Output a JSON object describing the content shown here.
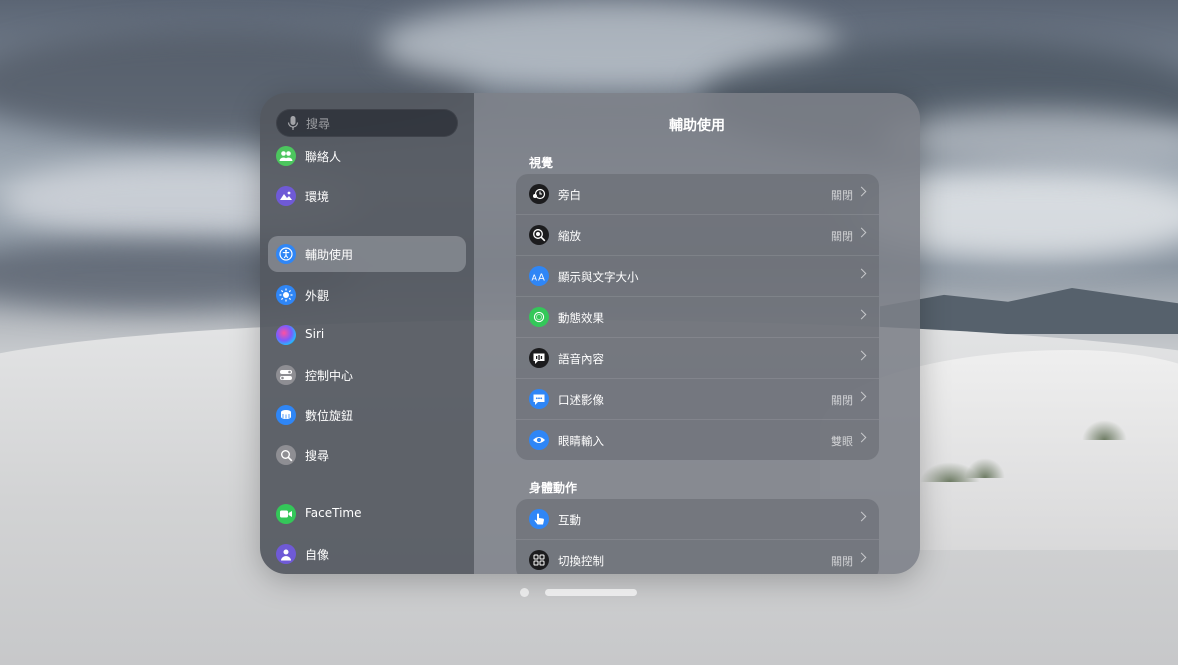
{
  "search": {
    "placeholder": "搜尋"
  },
  "sidebar": {
    "items": [
      {
        "label": "聯絡人",
        "icon": "contacts-icon",
        "color": "#4cc65e"
      },
      {
        "label": "環境",
        "icon": "environment-icon",
        "color": "#6f5ad6"
      },
      {
        "label": "輔助使用",
        "icon": "accessibility-icon",
        "color": "#2f86f6",
        "selected": true
      },
      {
        "label": "外觀",
        "icon": "appearance-icon",
        "color": "#2f86f6"
      },
      {
        "label": "Siri",
        "icon": "siri-icon",
        "color": "#3b3b48"
      },
      {
        "label": "控制中心",
        "icon": "control-center-icon",
        "color": "#8e8e93"
      },
      {
        "label": "數位旋鈕",
        "icon": "digital-crown-icon",
        "color": "#2f86f6"
      },
      {
        "label": "搜尋",
        "icon": "search-icon",
        "color": "#8e8e93"
      },
      {
        "label": "FaceTime",
        "icon": "facetime-icon",
        "color": "#34c759"
      },
      {
        "label": "自像",
        "icon": "persona-icon",
        "color": "#6f5ad6"
      }
    ]
  },
  "main": {
    "title": "輔助使用",
    "sections": [
      {
        "header": "視覺",
        "rows": [
          {
            "label": "旁白",
            "value": "關閉",
            "icon": "voiceover-icon",
            "color": "#1c1c1e"
          },
          {
            "label": "縮放",
            "value": "關閉",
            "icon": "zoom-icon",
            "color": "#1c1c1e"
          },
          {
            "label": "顯示與文字大小",
            "value": "",
            "icon": "text-size-icon",
            "color": "#2f86f6"
          },
          {
            "label": "動態效果",
            "value": "",
            "icon": "motion-icon",
            "color": "#34c759"
          },
          {
            "label": "語音內容",
            "value": "",
            "icon": "spoken-content-icon",
            "color": "#1c1c1e"
          },
          {
            "label": "口述影像",
            "value": "關閉",
            "icon": "audio-description-icon",
            "color": "#2f86f6"
          },
          {
            "label": "眼睛輸入",
            "value": "雙眼",
            "icon": "eye-input-icon",
            "color": "#2f86f6"
          }
        ]
      },
      {
        "header": "身體動作",
        "rows": [
          {
            "label": "互動",
            "value": "",
            "icon": "interaction-icon",
            "color": "#2f86f6"
          },
          {
            "label": "切換控制",
            "value": "關閉",
            "icon": "switch-control-icon",
            "color": "#1c1c1e"
          }
        ]
      }
    ]
  }
}
